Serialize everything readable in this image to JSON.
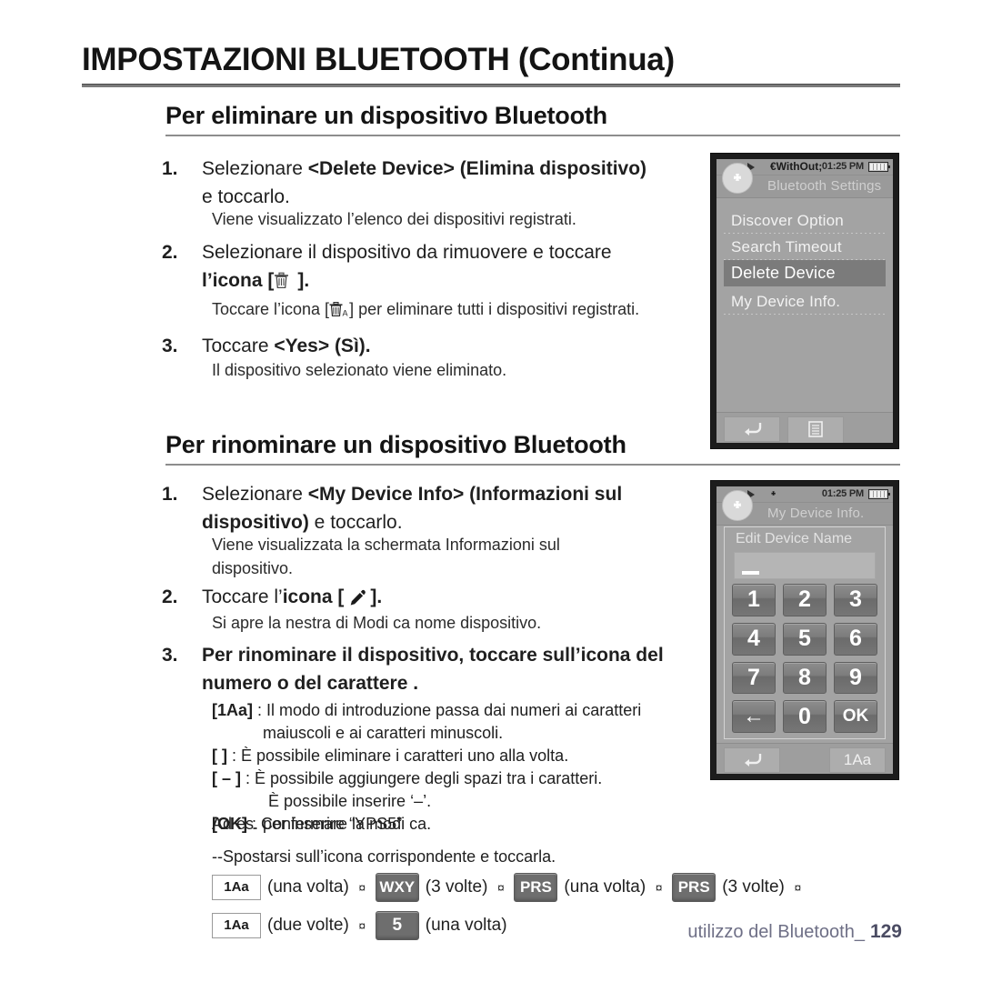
{
  "chapter": {
    "title": "IMPOSTAZIONI BLUETOOTH (Continua)"
  },
  "footer": {
    "text": "utilizzo del Bluetooth_",
    "page": "129"
  },
  "section1": {
    "heading": "Per eliminare un dispositivo Bluetooth",
    "step1": {
      "num": "1.",
      "line1_a": "Selezionare ",
      "line1_b": "<Delete Device> (Elimina dispositivo)",
      "line2": "e toccarlo.",
      "note": "Viene visualizzato l’elenco dei dispositivi registrati."
    },
    "step2": {
      "num": "2.",
      "line1": "Selezionare il dispositivo da rimuovere e toccare",
      "line2_a": "l’icona [",
      "line2_b": "].",
      "note_a": "Toccare l’icona [",
      "note_b": "] per eliminare tutti i dispositivi registrati."
    },
    "step3": {
      "num": "3.",
      "line1_a": "Toccare ",
      "line1_b": "<Yes> (Sì).",
      "note": "Il dispositivo selezionato viene eliminato."
    }
  },
  "section2": {
    "heading": "Per rinominare un dispositivo Bluetooth",
    "step1": {
      "num": "1.",
      "line1_a": "Selezionare ",
      "line1_b": "<My Device Info> (Informazioni sul",
      "line2_b": "dispositivo)",
      "line2_a": " e toccarlo.",
      "note1": "Viene visualizzata la schermata Informazioni sul",
      "note2": "dispositivo."
    },
    "step2": {
      "num": "2.",
      "line_a": "Toccare l’",
      "line_b": "icona",
      "line_c": " [",
      "line_d": "].",
      "note": "Si apre la  nestra di Modi ca nome dispositivo."
    },
    "step3": {
      "num": "3.",
      "line1": "Per rinominare il dispositivo, toccare sull’icona del",
      "line2": "numero o del carattere ."
    },
    "defs": [
      {
        "key": "[1Aa]",
        "sep": " : ",
        "text": "Il modo di introduzione passa dai numeri ai caratteri",
        "cont": "maiuscoli e ai caratteri minuscoli."
      },
      {
        "key": "[   ]",
        "sep": " : ",
        "text": "È possibile eliminare i caratteri uno alla volta.",
        "cont": ""
      },
      {
        "key": "[ – ]",
        "sep": " : ",
        "text": "È possibile aggiungere degli spazi tra i caratteri.",
        "cont": "È possibile inserire ‘–’."
      },
      {
        "key": "[OK]",
        "sep": " : ",
        "text": "Confermare la modi ca.",
        "cont": ""
      }
    ],
    "example_line": "Ad es. per inserire “YPS5”",
    "move_line": "--Spostarsi sull’icona corrispondente e toccarla.",
    "sequence": {
      "row1": [
        {
          "type": "tag",
          "label": "1Aa"
        },
        {
          "type": "text",
          "label": "(una volta)"
        },
        {
          "type": "arrow",
          "label": "¤"
        },
        {
          "type": "key",
          "label": "WXY"
        },
        {
          "type": "text",
          "label": "(3 volte)"
        },
        {
          "type": "arrow",
          "label": "¤"
        },
        {
          "type": "key",
          "label": "PRS"
        },
        {
          "type": "text",
          "label": "(una volta)"
        },
        {
          "type": "arrow",
          "label": "¤"
        },
        {
          "type": "key",
          "label": "PRS"
        },
        {
          "type": "text",
          "label": "(3 volte)"
        },
        {
          "type": "arrow",
          "label": "¤"
        }
      ],
      "row2": [
        {
          "type": "tag",
          "label": "1Aa"
        },
        {
          "type": "text",
          "label": "(due volte)"
        },
        {
          "type": "arrow",
          "label": "¤"
        },
        {
          "type": "keynum",
          "label": "5"
        },
        {
          "type": "text",
          "label": "(una volta)"
        }
      ]
    }
  },
  "device1": {
    "status": {
      "time": "01:25 PM"
    },
    "title": "Bluetooth Settings",
    "menu": [
      {
        "label": "Discover Option",
        "selected": false
      },
      {
        "label": "Search Timeout",
        "selected": false
      },
      {
        "label": "Delete Device",
        "selected": true
      },
      {
        "label": "My Device Info.",
        "selected": false
      }
    ],
    "soft_back": "↩",
    "soft_menu": "☰"
  },
  "device2": {
    "status": {
      "time": "01:25 PM"
    },
    "title": "My Device Info.",
    "panel_label": "Edit Device Name",
    "input_value": "",
    "keys": [
      "1",
      "2",
      "3",
      "4",
      "5",
      "6",
      "7",
      "8",
      "9",
      "←",
      "0",
      "OK"
    ],
    "soft_back": "↩",
    "soft_tag": "1Aa"
  },
  "colors": {
    "device_frame": "#1c1c1c",
    "screen_bg": "#a3a3a3",
    "selected_row": "#7b7b7b",
    "footer_text": "#6e6f86"
  }
}
